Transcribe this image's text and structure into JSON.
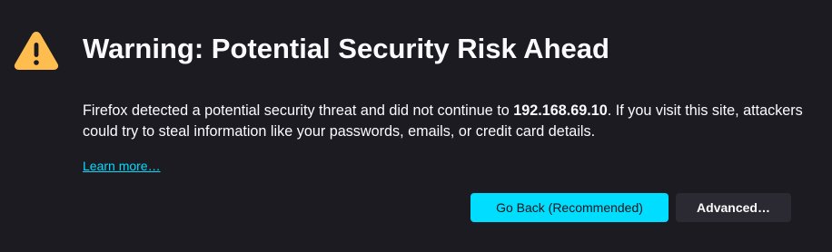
{
  "colors": {
    "background": "#1c1b22",
    "text": "#fbfbfe",
    "accent": "#00ddff",
    "warning_icon": "#ffbd4f",
    "secondary_button": "#2b2a33"
  },
  "icon": "warning-triangle-icon",
  "title": "Warning: Potential Security Risk Ahead",
  "description": {
    "before_host": "Firefox detected a potential security threat and did not continue to ",
    "host": "192.168.69.10",
    "after_host": ". If you visit this site, attackers could try to steal information like your passwords, emails, or credit card details."
  },
  "learn_more_label": "Learn more…",
  "buttons": {
    "go_back_label": "Go Back (Recommended)",
    "advanced_label": "Advanced…"
  }
}
